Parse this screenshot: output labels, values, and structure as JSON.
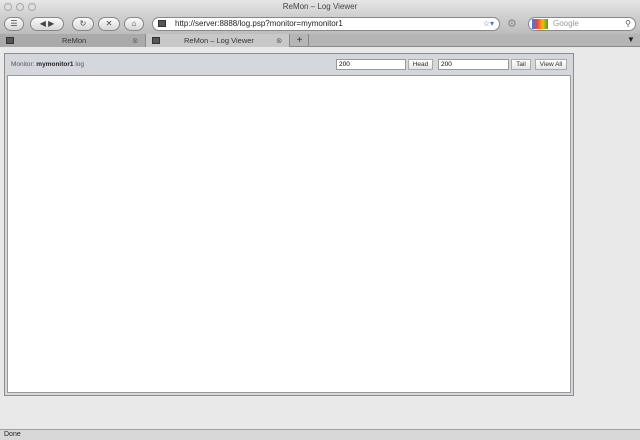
{
  "window": {
    "title": "ReMon – Log Viewer"
  },
  "toolbar": {
    "url": "http://server:8888/log.psp?monitor=mymonitor1",
    "search_placeholder": "Google"
  },
  "tabs": [
    {
      "label": "ReMon",
      "active": false
    },
    {
      "label": "ReMon – Log Viewer",
      "active": true
    }
  ],
  "page": {
    "monitor_label": "Monitor:",
    "monitor_name": "mymonitor1",
    "log_suffix": "log",
    "head_value": "200",
    "head_button": "Head",
    "tail_value": "200",
    "tail_button": "Tail",
    "view_all_button": "View All"
  },
  "status": {
    "text": "Done"
  }
}
